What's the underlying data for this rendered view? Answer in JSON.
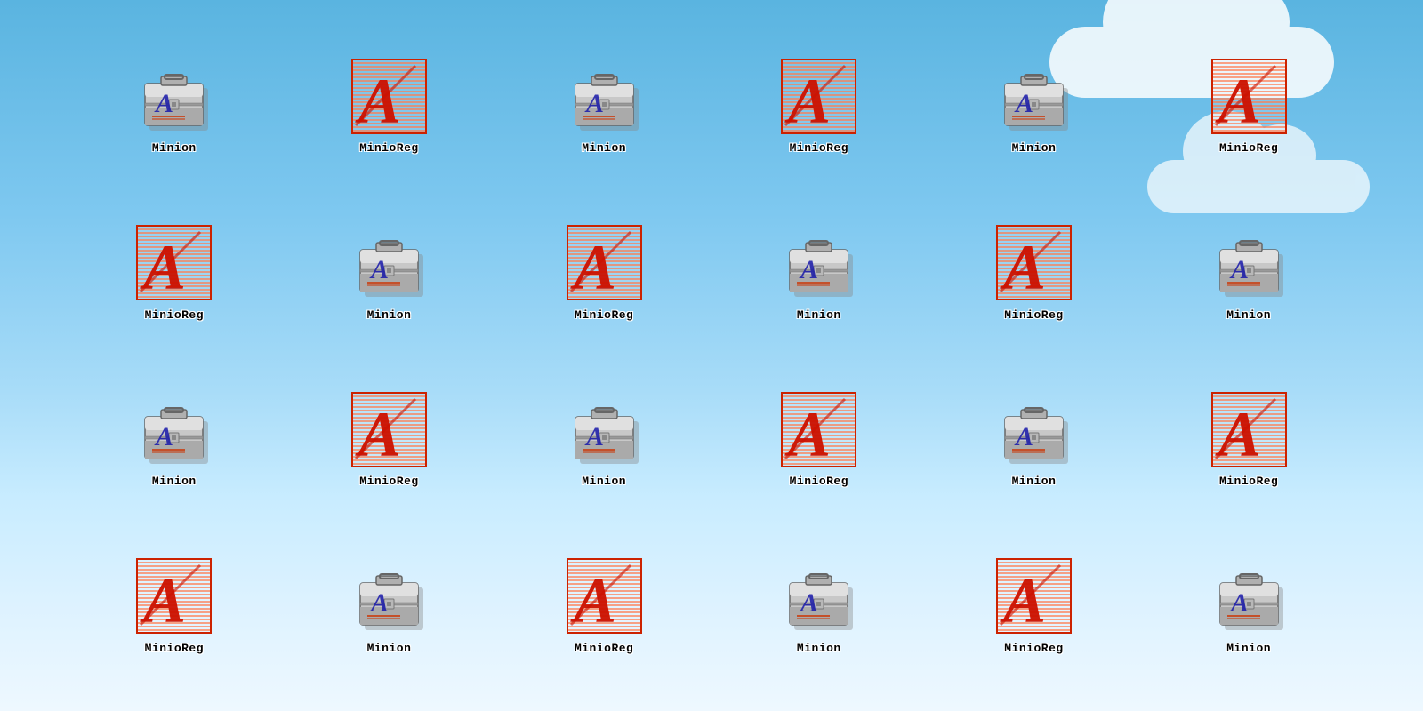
{
  "grid": {
    "rows": [
      [
        {
          "type": "briefcase",
          "label": "Minion"
        },
        {
          "type": "fonta",
          "label": "MinioReg"
        },
        {
          "type": "briefcase",
          "label": "Minion"
        },
        {
          "type": "fonta",
          "label": "MinioReg"
        },
        {
          "type": "briefcase",
          "label": "Minion"
        },
        {
          "type": "fonta",
          "label": "MinioReg"
        }
      ],
      [
        {
          "type": "fonta",
          "label": "MinioReg"
        },
        {
          "type": "briefcase",
          "label": "Minion"
        },
        {
          "type": "fonta",
          "label": "MinioReg"
        },
        {
          "type": "briefcase",
          "label": "Minion"
        },
        {
          "type": "fonta",
          "label": "MinioReg"
        },
        {
          "type": "briefcase",
          "label": "Minion"
        }
      ],
      [
        {
          "type": "briefcase",
          "label": "Minion"
        },
        {
          "type": "fonta",
          "label": "MinioReg"
        },
        {
          "type": "briefcase",
          "label": "Minion"
        },
        {
          "type": "fonta",
          "label": "MinioReg"
        },
        {
          "type": "briefcase",
          "label": "Minion"
        },
        {
          "type": "fonta",
          "label": "MinioReg"
        }
      ],
      [
        {
          "type": "fonta",
          "label": "MinioReg"
        },
        {
          "type": "briefcase",
          "label": "Minion"
        },
        {
          "type": "fonta",
          "label": "MinioReg"
        },
        {
          "type": "briefcase",
          "label": "Minion"
        },
        {
          "type": "fonta",
          "label": "MinioReg"
        },
        {
          "type": "briefcase",
          "label": "Minion"
        }
      ]
    ]
  }
}
